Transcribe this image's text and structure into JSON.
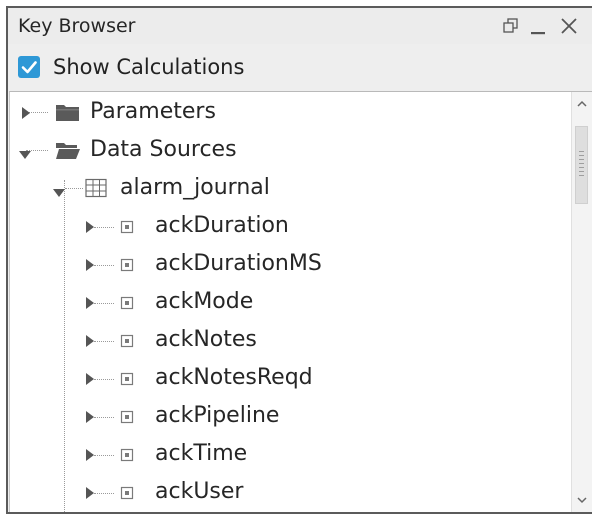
{
  "window": {
    "title": "Key Browser",
    "buttons": [
      {
        "name": "restore",
        "icon": "restore-window-icon"
      },
      {
        "name": "minimize",
        "icon": "minimize-icon"
      },
      {
        "name": "close",
        "icon": "close-icon"
      }
    ]
  },
  "options": {
    "show_calculations_label": "Show Calculations",
    "show_calculations_checked": true,
    "accent_color": "#2e98d6"
  },
  "tree": {
    "parameters": {
      "label": "Parameters",
      "icon": "folder-closed-icon",
      "expanded": false
    },
    "data_sources": {
      "label": "Data Sources",
      "icon": "folder-open-icon",
      "expanded": true
    },
    "alarm_journal": {
      "label": "alarm_journal",
      "icon": "table-icon",
      "expanded": true
    },
    "fields": [
      {
        "label": "ackDuration",
        "icon": "field-icon"
      },
      {
        "label": "ackDurationMS",
        "icon": "field-icon"
      },
      {
        "label": "ackMode",
        "icon": "field-icon"
      },
      {
        "label": "ackNotes",
        "icon": "field-icon"
      },
      {
        "label": "ackNotesReqd",
        "icon": "field-icon"
      },
      {
        "label": "ackPipeline",
        "icon": "field-icon"
      },
      {
        "label": "ackTime",
        "icon": "field-icon"
      },
      {
        "label": "ackUser",
        "icon": "field-icon"
      }
    ]
  },
  "scrollbar": {
    "up_icon": "scroll-up-icon",
    "down_icon": "scroll-down-icon"
  }
}
